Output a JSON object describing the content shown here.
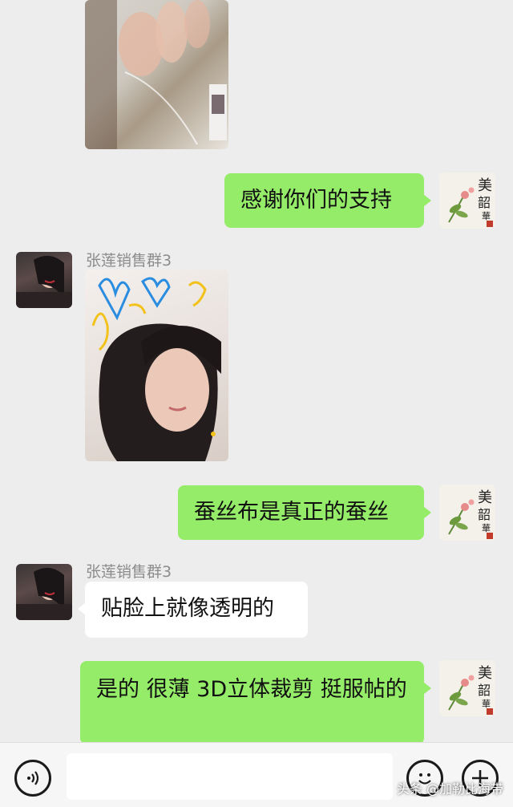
{
  "chat": {
    "sender_name": "张莲销售群3",
    "messages": [
      {
        "text": "感谢你们的支持"
      },
      {
        "text": "蚕丝布是真正的蚕丝"
      },
      {
        "text": "贴脸上就像透明的"
      },
      {
        "text": "是的 很薄 3D立体裁剪 挺服帖的"
      }
    ]
  },
  "self_avatar": {
    "char1": "美",
    "char2": "韶",
    "char3": "華"
  },
  "input_bar": {
    "voice_icon": "voice-icon",
    "emoji_icon": "emoji-icon",
    "plus_icon": "plus-icon",
    "input_value": ""
  },
  "watermark": "头条 @加勒比海带",
  "colors": {
    "self_bubble": "#95ec69",
    "other_bubble": "#ffffff",
    "background": "#ededed"
  }
}
